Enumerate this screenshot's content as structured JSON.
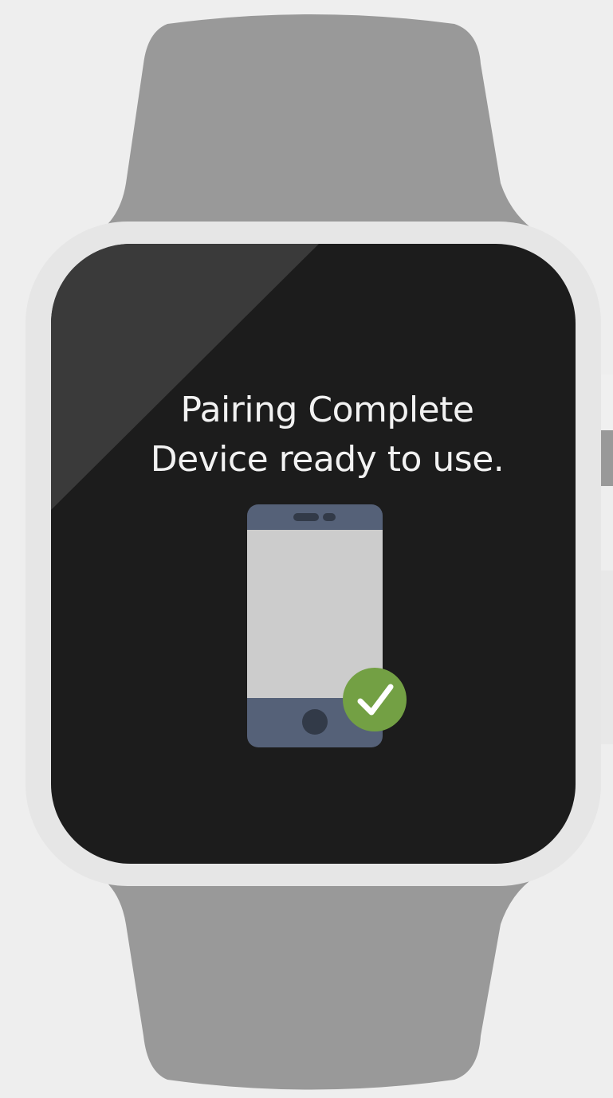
{
  "screen": {
    "title": "Pairing Complete",
    "subtitle": "Device ready to use."
  },
  "icons": {
    "watch": "smartwatch-icon",
    "phone": "smartphone-icon",
    "status": "checkmark-icon"
  },
  "colors": {
    "background": "#eeeeee",
    "band": "#999999",
    "case": "#e6e6e6",
    "screen": "#1c1c1c",
    "screen_glare": "#3a3a3a",
    "text": "#f2f2f2",
    "phone_body": "#556178",
    "phone_screen": "#cccccc",
    "phone_button": "#323a48",
    "success": "#73a044",
    "check": "#ffffff"
  }
}
